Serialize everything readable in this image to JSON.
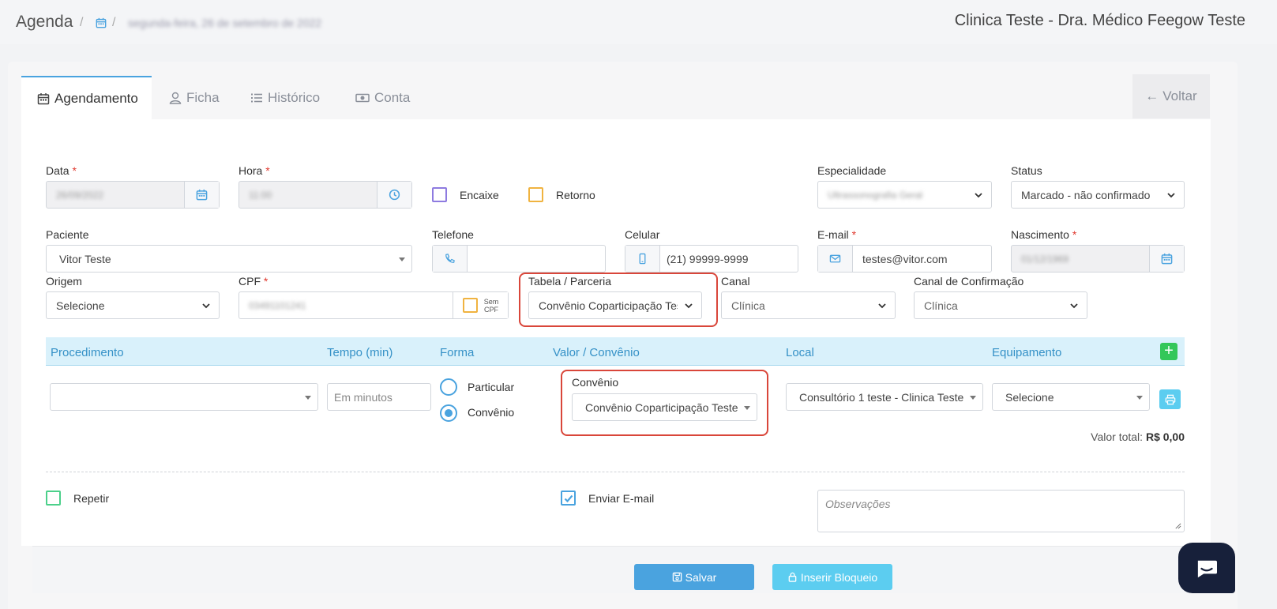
{
  "breadcrumb": {
    "title": "Agenda",
    "date": "segunda-feira, 26 de setembro de 2022"
  },
  "clinic_name": "Clinica Teste - Dra. Médico Feegow Teste",
  "tabs": [
    {
      "label": "Agendamento",
      "icon": "calendar-icon"
    },
    {
      "label": "Ficha",
      "icon": "user-icon"
    },
    {
      "label": "Histórico",
      "icon": "list-icon"
    },
    {
      "label": "Conta",
      "icon": "money-icon"
    }
  ],
  "back_label": "Voltar",
  "form": {
    "data": {
      "label": "Data",
      "value": "26/09/2022"
    },
    "hora": {
      "label": "Hora",
      "value": "11:00"
    },
    "encaixe_label": "Encaixe",
    "retorno_label": "Retorno",
    "especialidade": {
      "label": "Especialidade",
      "value": "Ultrassonografia Geral"
    },
    "status": {
      "label": "Status",
      "value": "Marcado - não confirmado"
    },
    "paciente": {
      "label": "Paciente",
      "value": "Vitor Teste"
    },
    "telefone": {
      "label": "Telefone",
      "value": ""
    },
    "celular": {
      "label": "Celular",
      "value": "(21) 99999-9999"
    },
    "email": {
      "label": "E-mail",
      "value": "testes@vitor.com"
    },
    "nascimento": {
      "label": "Nascimento",
      "value": "01/12/1969"
    },
    "origem": {
      "label": "Origem",
      "value": "Selecione"
    },
    "cpf": {
      "label": "CPF",
      "value": "03491101241",
      "sem_cpf_line1": "Sem",
      "sem_cpf_line2": "CPF"
    },
    "tabela": {
      "label": "Tabela / Parceria",
      "value": "Convênio Coparticipação Test"
    },
    "canal": {
      "label": "Canal",
      "value": "Clínica"
    },
    "canal_confirmacao": {
      "label": "Canal de Confirmação",
      "value": "Clínica"
    }
  },
  "procedimentos": {
    "headers": [
      "Procedimento",
      "Tempo (min)",
      "Forma",
      "Valor / Convênio",
      "Local",
      "Equipamento"
    ],
    "tempo_placeholder": "Em minutos",
    "forma_options": [
      "Particular",
      "Convênio"
    ],
    "forma_selected": "Convênio",
    "convenio_label": "Convênio",
    "convenio_value": "Convênio Coparticipação Teste",
    "local_value": "Consultório 1 teste - Clinica Teste",
    "equipamento_value": "Selecione",
    "valor_total_label": "Valor total:",
    "valor_total_value": "R$ 0,00"
  },
  "repetir_label": "Repetir",
  "enviar_email_label": "Enviar E-mail",
  "observacoes_placeholder": "Observações",
  "buttons": {
    "salvar": "Salvar",
    "inserir_bloqueio": "Inserir Bloqueio"
  },
  "colors": {
    "accent": "#4aa3df",
    "highlight": "#d9463a",
    "save": "#4aa3df",
    "block": "#5ccdf0"
  }
}
